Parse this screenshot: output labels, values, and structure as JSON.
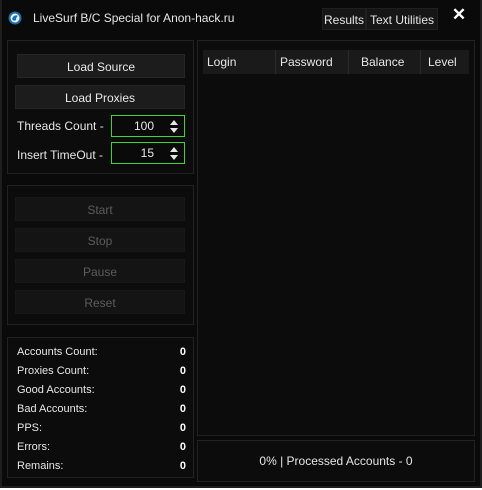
{
  "colors": {
    "accent": "#22e01c",
    "background": "#0a0a0a",
    "spin_border": "#3fd43a"
  },
  "window": {
    "title": "LiveSurf B/C Special for Anon-hack.ru",
    "logo_icon": "bird-logo-icon"
  },
  "topbar": {
    "results_label": "Results",
    "text_utilities_label": "Text Utilities",
    "close_label": "✕"
  },
  "source": {
    "load_source_label": "Load Source",
    "load_proxies_label": "Load Proxies"
  },
  "settings": {
    "threads_label": "Threads Count -",
    "threads_value": "100",
    "timeout_label": "Insert TimeOut -",
    "timeout_value": "15"
  },
  "controls": {
    "start_label": "Start",
    "stop_label": "Stop",
    "pause_label": "Pause",
    "reset_label": "Reset"
  },
  "stats": [
    {
      "label": "Accounts Count:",
      "value": "0"
    },
    {
      "label": "Proxies Count:",
      "value": "0"
    },
    {
      "label": "Good Accounts:",
      "value": "0"
    },
    {
      "label": "Bad Accounts:",
      "value": "0"
    },
    {
      "label": "PPS:",
      "value": "0"
    },
    {
      "label": "Errors:",
      "value": "0"
    },
    {
      "label": "Remains:",
      "value": "0"
    }
  ],
  "grid": {
    "columns": [
      "Login",
      "Password",
      "Balance",
      "Level"
    ]
  },
  "status": {
    "text": "0% | Processed Accounts - 0"
  }
}
